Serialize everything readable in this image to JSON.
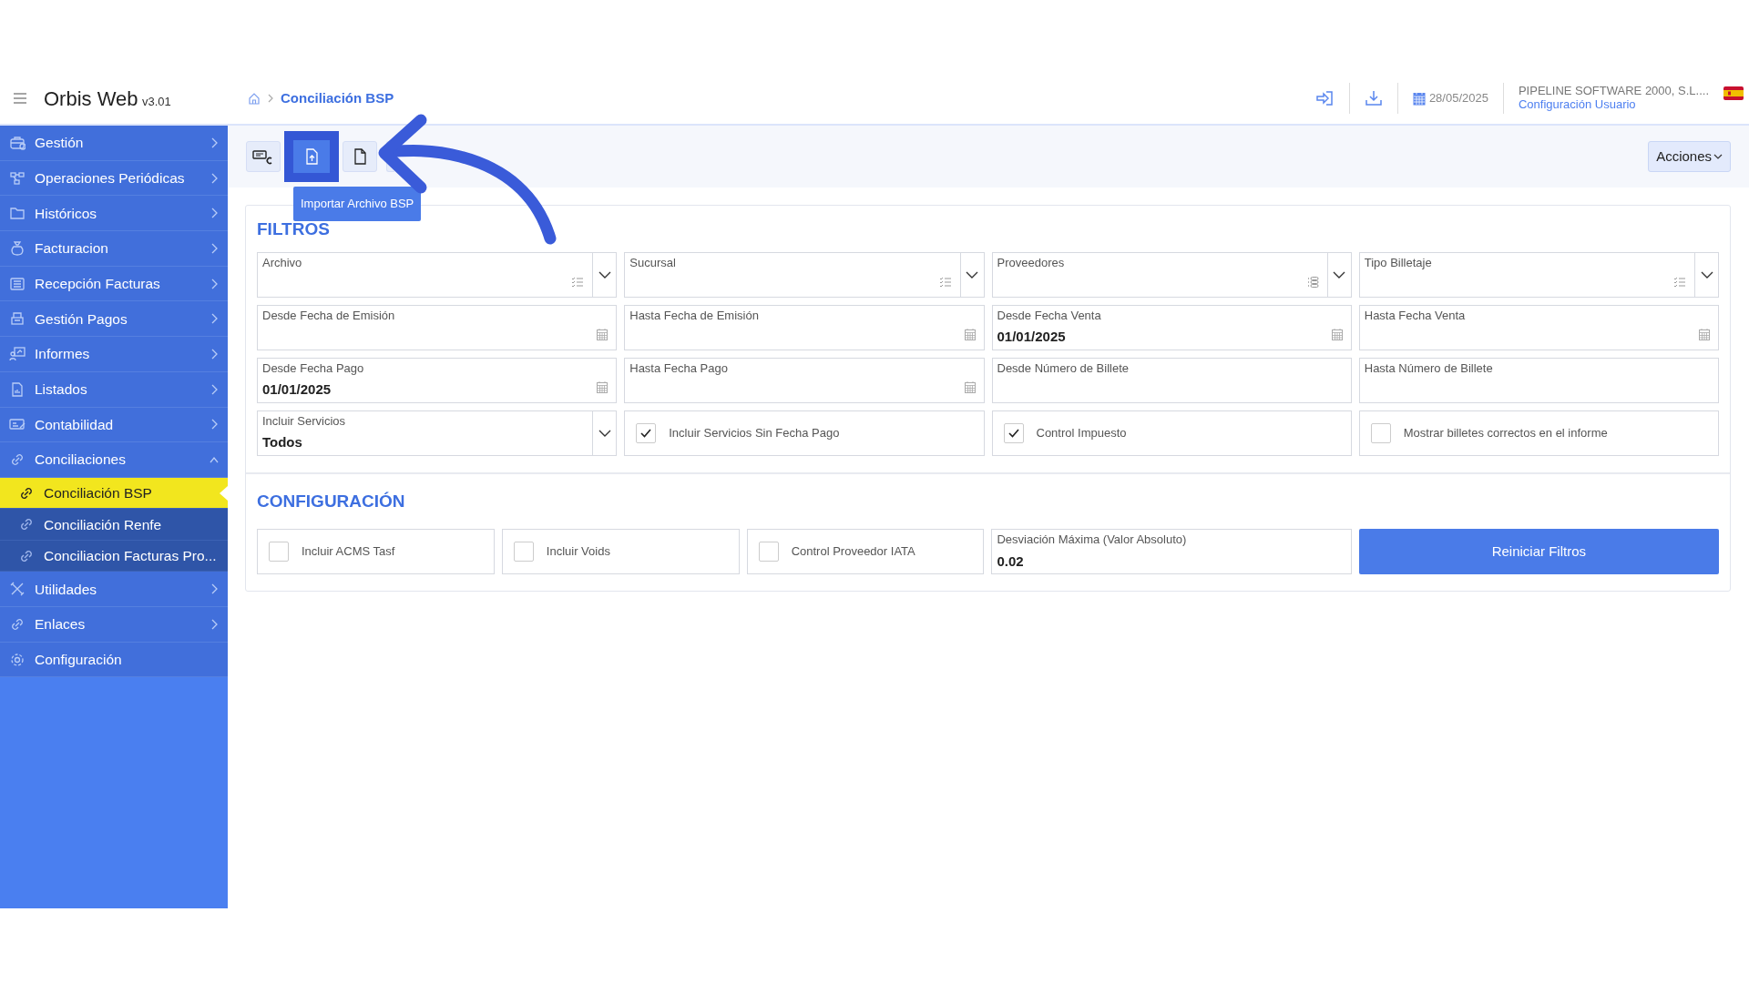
{
  "app": {
    "name": "Orbis Web",
    "version": "v3.01"
  },
  "breadcrumb": {
    "current": "Conciliación BSP"
  },
  "header": {
    "date": "28/05/2025",
    "company": "PIPELINE SOFTWARE 2000, S.L....",
    "user_link": "Configuración Usuario"
  },
  "sidebar": {
    "items": [
      {
        "label": "Gestión",
        "expanded": false
      },
      {
        "label": "Operaciones Periódicas",
        "expanded": false
      },
      {
        "label": "Históricos",
        "expanded": false
      },
      {
        "label": "Facturacion",
        "expanded": false
      },
      {
        "label": "Recepción Facturas",
        "expanded": false
      },
      {
        "label": "Gestión Pagos",
        "expanded": false
      },
      {
        "label": "Informes",
        "expanded": false
      },
      {
        "label": "Listados",
        "expanded": false
      },
      {
        "label": "Contabilidad",
        "expanded": false
      },
      {
        "label": "Conciliaciones",
        "expanded": true,
        "children": [
          {
            "label": "Conciliación BSP",
            "selected": true
          },
          {
            "label": "Conciliación Renfe",
            "selected": false
          },
          {
            "label": "Conciliacion Facturas Pro...",
            "selected": false
          }
        ]
      },
      {
        "label": "Utilidades",
        "expanded": false
      },
      {
        "label": "Enlaces",
        "expanded": false
      },
      {
        "label": "Configuración"
      }
    ]
  },
  "toolbar": {
    "buttons": [
      {
        "selected": false
      },
      {
        "selected": true
      },
      {
        "selected": false
      },
      {
        "selected": false
      }
    ],
    "tooltip": "Importar Archivo BSP",
    "actions": "Acciones"
  },
  "filters": {
    "title": "FILTROS",
    "fields": [
      {
        "kind": "select",
        "label": "Archivo"
      },
      {
        "kind": "select",
        "label": "Sucursal"
      },
      {
        "kind": "select",
        "label": "Proveedores"
      },
      {
        "kind": "select",
        "label": "Tipo Billetaje"
      },
      {
        "kind": "date",
        "label": "Desde Fecha de Emisión"
      },
      {
        "kind": "date",
        "label": "Hasta Fecha de Emisión"
      },
      {
        "kind": "date",
        "label": "Desde Fecha Venta",
        "value": "01/01/2025"
      },
      {
        "kind": "date",
        "label": "Hasta Fecha Venta"
      },
      {
        "kind": "date",
        "label": "Desde Fecha Pago",
        "value": "01/01/2025"
      },
      {
        "kind": "date",
        "label": "Hasta Fecha Pago"
      },
      {
        "kind": "text",
        "label": "Desde Número de Billete"
      },
      {
        "kind": "text",
        "label": "Hasta Número de Billete"
      },
      {
        "kind": "dropdown",
        "label": "Incluir Servicios",
        "value": "Todos"
      },
      {
        "kind": "checkbox",
        "label": "Incluir Servicios Sin Fecha Pago",
        "checked": true
      },
      {
        "kind": "checkbox",
        "label": "Control Impuesto",
        "checked": true
      },
      {
        "kind": "checkbox",
        "label": "Mostrar billetes correctos en el informe",
        "checked": false
      }
    ]
  },
  "configuration": {
    "title": "CONFIGURACIÓN",
    "fields": [
      {
        "kind": "checkbox",
        "label": "Incluir ACMS Tasf",
        "checked": false
      },
      {
        "kind": "checkbox",
        "label": "Incluir Voids",
        "checked": false
      },
      {
        "kind": "checkbox",
        "label": "Control Proveedor IATA",
        "checked": false
      },
      {
        "kind": "text",
        "label": "Desviación Máxima (Valor Absoluto)",
        "value": "0.02"
      }
    ],
    "reset_button": "Reiniciar Filtros"
  }
}
